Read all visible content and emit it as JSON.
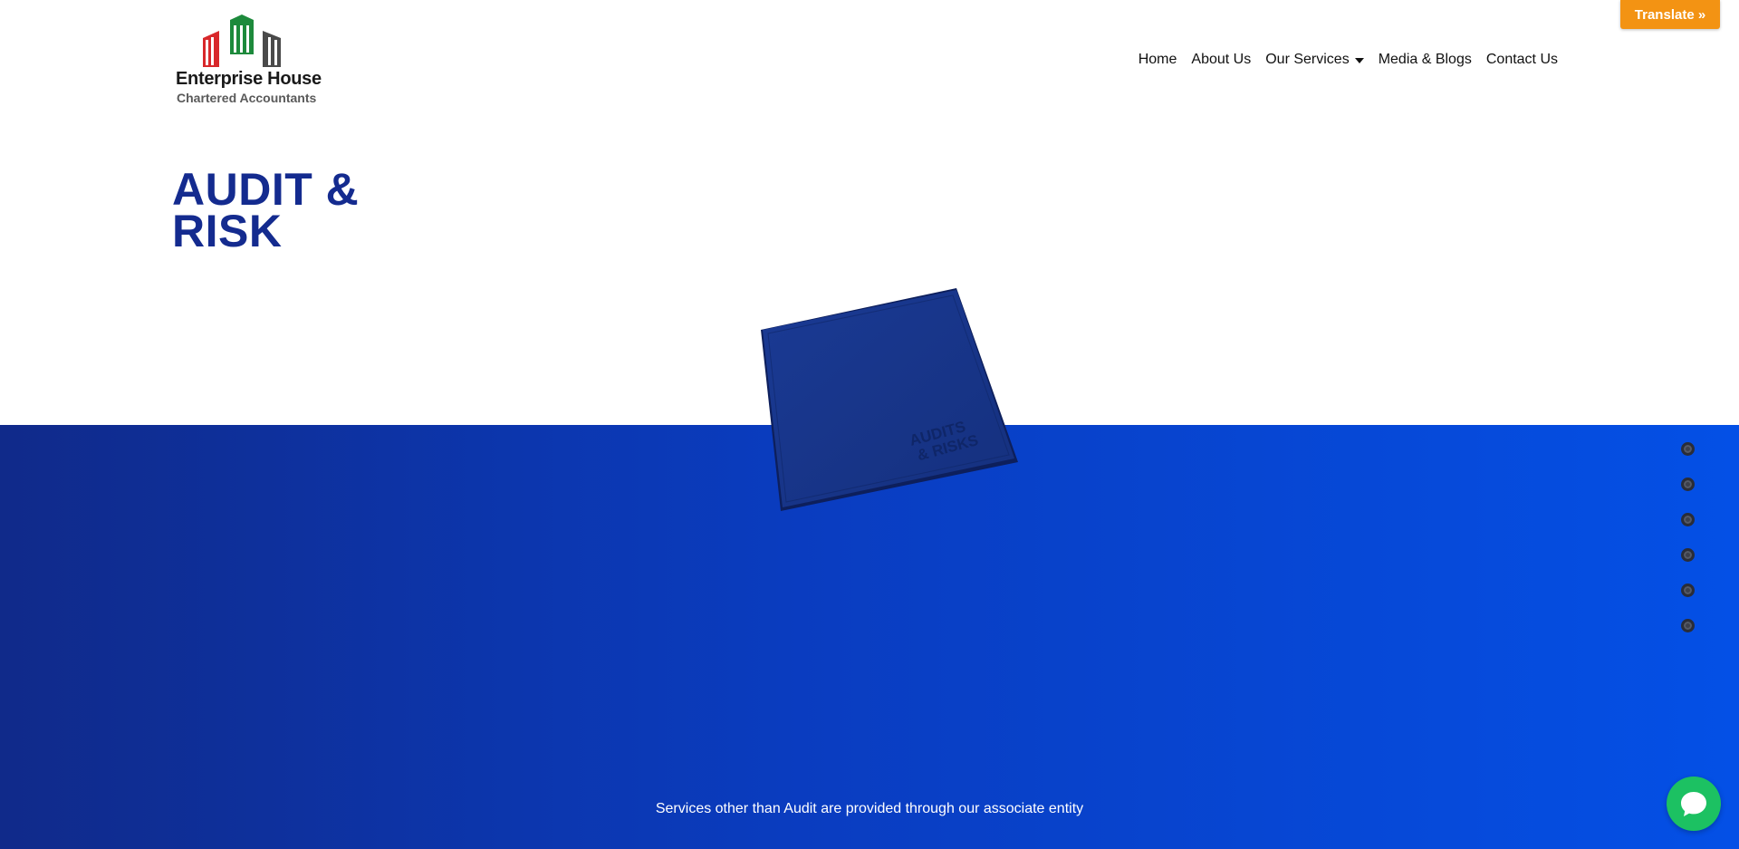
{
  "logo": {
    "name": "Enterprise House",
    "tagline": "Chartered Accountants"
  },
  "nav": {
    "items": [
      {
        "label": "Home"
      },
      {
        "label": "About Us"
      },
      {
        "label": "Our Services",
        "has_dropdown": true
      },
      {
        "label": "Media & Blogs"
      },
      {
        "label": "Contact Us"
      }
    ]
  },
  "translate": {
    "label": "Translate »"
  },
  "hero": {
    "title_line1": "AUDIT &",
    "title_line2": "RISK",
    "book_text_line1": "AUDITS",
    "book_text_line2": "& RISKS"
  },
  "slider": {
    "dot_count": 6
  },
  "footer": {
    "note": "Services other than Audit are provided through our associate entity"
  },
  "colors": {
    "title_blue": "#142b8f",
    "band_start": "#102a8a",
    "band_end": "#0450e6",
    "translate_orange": "#f39313",
    "chat_green": "#1cc162",
    "logo_red": "#d8282b",
    "logo_green": "#1d8a3c",
    "logo_gray": "#4a4a4a"
  },
  "icons": {
    "logo_mark": "building-columns-icon",
    "dropdown": "caret-down-icon",
    "chat": "chat-bubble-icon"
  }
}
